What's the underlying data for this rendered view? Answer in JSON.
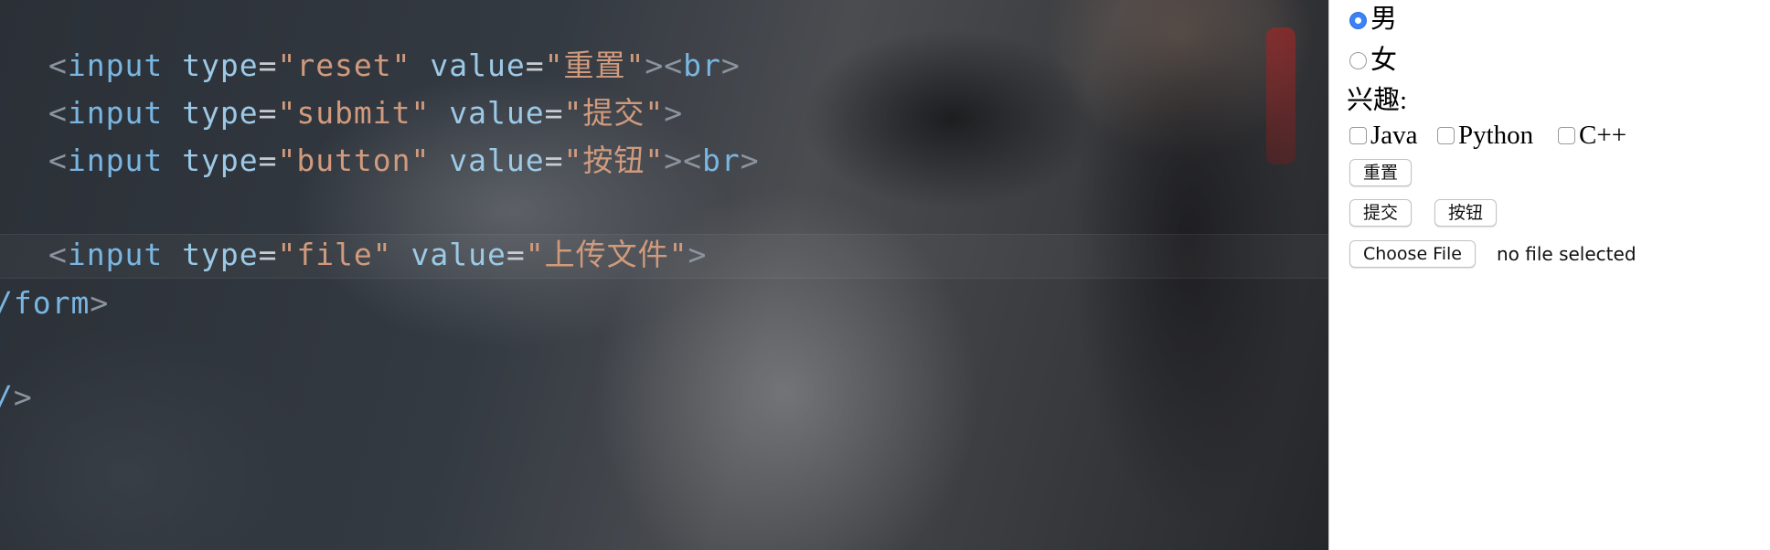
{
  "editor": {
    "lines": [
      {
        "lt": "<",
        "tag": "input",
        "attr1": "type",
        "eq1": "=",
        "val1": "\"reset\"",
        "attr2": "value",
        "eq2": "=",
        "val2": "\"重置\"",
        "close": "><",
        "tag2": "br",
        "end": ">"
      },
      {
        "lt": "<",
        "tag": "input",
        "attr1": "type",
        "eq1": "=",
        "val1": "\"submit\"",
        "attr2": "value",
        "eq2": "=",
        "val2": "\"提交\"",
        "end": ">"
      },
      {
        "lt": "<",
        "tag": "input",
        "attr1": "type",
        "eq1": "=",
        "val1": "\"button\"",
        "attr2": "value",
        "eq2": "=",
        "val2": "\"按钮\"",
        "close": "><",
        "tag2": "br",
        "end": ">"
      },
      {
        "lt": "<",
        "tag": "input",
        "attr1": "type",
        "eq1": "=",
        "val1": "\"file\"",
        "attr2": "value",
        "eq2": "=",
        "val2": "\"上传文件\"",
        "end": ">"
      },
      {
        "slash": "/",
        "tag": "form",
        "end": ">"
      },
      {
        "slash": "/",
        "end": ">"
      }
    ]
  },
  "preview": {
    "gender": {
      "options": [
        {
          "label": "男",
          "checked": true
        },
        {
          "label": "女",
          "checked": false
        }
      ]
    },
    "interest_label": "兴趣:",
    "interests": [
      {
        "label": "Java",
        "checked": false
      },
      {
        "label": "Python",
        "checked": false
      },
      {
        "label": "C++",
        "checked": false
      }
    ],
    "reset_button": "重置",
    "submit_button": "提交",
    "plain_button": "按钮",
    "file_input": {
      "button": "Choose File",
      "status": "no file selected"
    }
  }
}
